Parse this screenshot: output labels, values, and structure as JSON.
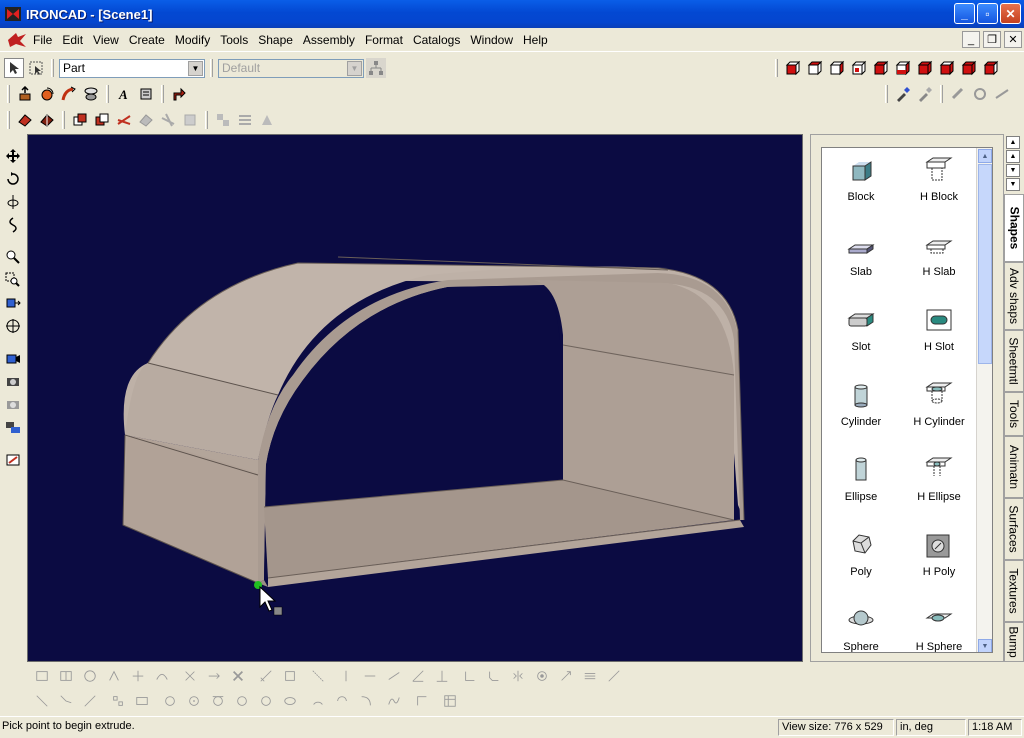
{
  "window": {
    "title": "IRONCAD - [Scene1]"
  },
  "menu": {
    "items": [
      "File",
      "Edit",
      "View",
      "Create",
      "Modify",
      "Tools",
      "Shape",
      "Assembly",
      "Format",
      "Catalogs",
      "Window",
      "Help"
    ]
  },
  "toolbar": {
    "part_select": "Part",
    "style_select": "Default"
  },
  "catalog": {
    "items": [
      "Block",
      "H Block",
      "Slab",
      "H Slab",
      "Slot",
      "H Slot",
      "Cylinder",
      "H Cylinder",
      "Ellipse",
      "H Ellipse",
      "Poly",
      "H Poly",
      "Sphere",
      "H Sphere"
    ],
    "tabs": [
      "Shapes",
      "Adv shaps",
      "Sheetmtl",
      "Tools",
      "Animatn",
      "Surfaces",
      "Textures",
      "Bump"
    ]
  },
  "status": {
    "message": "Pick point to begin extrude.",
    "view_size": "View size:  776 x  529",
    "units": "in, deg",
    "time": "1:18 AM"
  },
  "colors": {
    "viewport_bg": "#0b0b42",
    "model": "#b9aca2",
    "titlebar": "#0348d2"
  }
}
